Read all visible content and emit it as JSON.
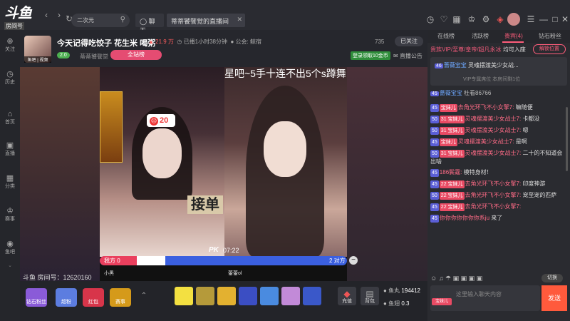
{
  "topbar": {
    "logo_text": "斗鱼",
    "room_sub": "房间号",
    "room_id": "10519486",
    "back_icon": "arrow-left-icon",
    "forward_icon": "arrow-right-icon",
    "refresh_icon": "refresh-icon",
    "search_text": "二次元",
    "chat_tab": "聊天",
    "room_tab": "蒂蒂饕餮觉的直播间",
    "mute_icon": "speaker-icon",
    "close_icon": "close-icon",
    "right_icons": [
      "clock-icon",
      "heart-icon",
      "calendar-icon",
      "trophy-icon",
      "settings-icon",
      "gift-icon",
      "avatar",
      "menu-icon",
      "minimize-icon",
      "maximize-icon",
      "close-icon"
    ]
  },
  "left_nav": [
    {
      "icon": "plus-icon",
      "label": "关注"
    },
    {
      "icon": "clock-icon",
      "label": "历史"
    },
    {
      "icon": "home-icon",
      "label": "首页"
    },
    {
      "icon": "tv-icon",
      "label": "直播"
    },
    {
      "icon": "grid-icon",
      "label": "分类"
    },
    {
      "icon": "trophy-icon",
      "label": "赛事"
    },
    {
      "icon": "fish-icon",
      "label": "鱼吧"
    }
  ],
  "header": {
    "avatar_caption": "鱼吧 | 视频",
    "title": "今天记得吃饺子 花生米 喝粥",
    "hot": "21.9 万",
    "live_time": "已播1小时38分钟",
    "notice": "公会: 鲸宿",
    "level": "2.0",
    "anchor": "蒂蒂饕餮觉",
    "all_list": "全站榜",
    "viewers": "735",
    "follow": "已关注",
    "login_badge": "登录领取10金币",
    "announce": "直播公告"
  },
  "video": {
    "stream_title": "星吧~5手十连不出5个s蹲舞",
    "score": "20",
    "jiedan": "接单",
    "pk_label": "PK",
    "pk_time": "07:22",
    "pk_ours": "我方 0",
    "pk_theirs": "2 对方",
    "pk_ours_fraction": 0.15,
    "user1": "小黑",
    "user2": "蕾蕾ol",
    "watermark": "斗鱼 房间号：12620160"
  },
  "bottom": {
    "items": [
      {
        "label": "钻石粉丝",
        "color": "#8a5bd8"
      },
      {
        "label": "超粉",
        "color": "#5c7de0"
      },
      {
        "label": "红包",
        "color": "#d8354a"
      },
      {
        "label": "赛事",
        "color": "#d59a1a"
      }
    ],
    "gifts": [
      "#f3e041",
      "#b59a3a",
      "#e3b130",
      "#3b4ec3",
      "#4a8be0",
      "#c28ad8",
      "#3a58c9"
    ],
    "charge": "充值",
    "pack": "背包",
    "fish_ball_label": "鱼丸",
    "fish_ball": "194412",
    "fish_bar_label": "鱼翅",
    "fish_bar": "0.3"
  },
  "right": {
    "tabs": [
      "在线榜",
      "活跃榜",
      "贵宾(4)",
      "钻石粉丝"
    ],
    "active_tab": 2,
    "noble_text": "贵族VIP/至尊/皇帝/超凡永冰",
    "noble_tail": "均可入座",
    "noble_btn": "解锁位置",
    "pin_level": "46",
    "pin_name": "蔷薇宝宝",
    "pin_msg": "灵魂摆渡美少女战...",
    "vip_line": "VIP专属席位 本房间剩1位",
    "tag_level": "45",
    "tag_name": "蔷薇宝宝",
    "tag_msg": "杜看86766",
    "messages": [
      {
        "lvl": "45",
        "fan": "宝妹儿",
        "name": "去角光环飞不小女擎7:",
        "text": "嘛随便"
      },
      {
        "lvl": "50",
        "fan": "31 宝妹儿",
        "name": "灵魂摆渡美少女战士7:",
        "text": "卡都没"
      },
      {
        "lvl": "50",
        "fan": "31 宝妹儿",
        "name": "灵魂摆渡美少女战士7:",
        "text": "嗯"
      },
      {
        "lvl": "45",
        "fan": "宝妹儿",
        "name": "灵魂摆渡美少女战士7:",
        "text": "是啊"
      },
      {
        "lvl": "50",
        "fan": "31 宝妹儿",
        "name": "灵魂摆渡美少女战士7:",
        "text": "二十的不知道会出啥"
      },
      {
        "lvl": "45",
        "fan": "",
        "name": "186鬓霆:",
        "text": "模特身材！"
      },
      {
        "lvl": "45",
        "fan": "22 宝妹儿",
        "name": "去角光环飞不小女擎7:",
        "text": "印度神游"
      },
      {
        "lvl": "50",
        "fan": "22 宝妹儿",
        "name": "去角光环飞不小女擎7:",
        "text": "宠至宠的匹萨"
      },
      {
        "lvl": "45",
        "fan": "22 宝妹儿",
        "name": "去角光环飞不小女擎7:",
        "text": ""
      },
      {
        "lvl": "45",
        "fan": "",
        "name": "你你你你你你你系ju",
        "text": "来了"
      }
    ],
    "switch": "切换",
    "input_placeholder": "这里输入聊天内容",
    "input_tag": "宝妹儿",
    "send": "发送"
  }
}
